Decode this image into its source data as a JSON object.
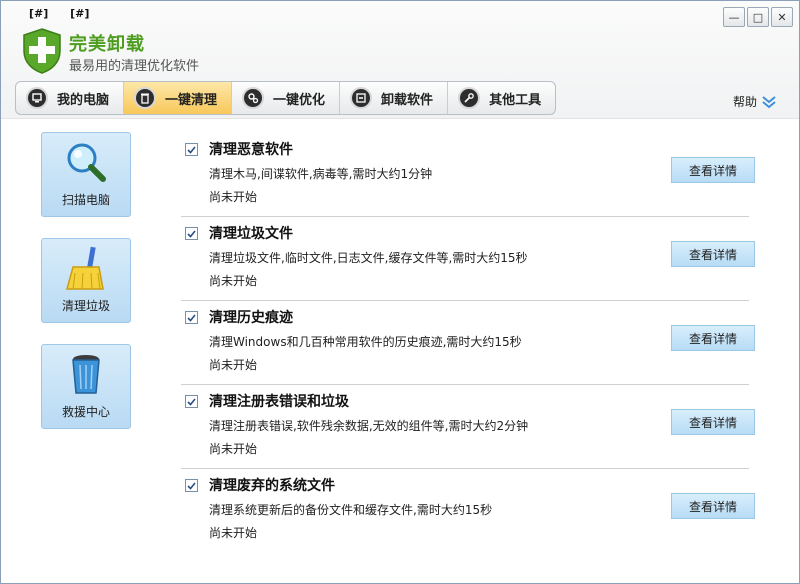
{
  "window": {
    "tags": [
      "[#]",
      "[#]"
    ],
    "title": "完美卸载",
    "subtitle": "最易用的清理优化软件",
    "controls": {
      "minimize": "—",
      "maximize": "□",
      "close": "✕"
    }
  },
  "tabs": [
    {
      "label": "我的电脑",
      "icon": "computer-icon",
      "active": false
    },
    {
      "label": "一键清理",
      "icon": "trash-icon",
      "active": true
    },
    {
      "label": "一键优化",
      "icon": "gears-icon",
      "active": false
    },
    {
      "label": "卸载软件",
      "icon": "uninstall-icon",
      "active": false
    },
    {
      "label": "其他工具",
      "icon": "tools-icon",
      "active": false
    }
  ],
  "help": {
    "label": "帮助"
  },
  "sidebar": [
    {
      "label": "扫描电脑",
      "icon": "magnifier-icon"
    },
    {
      "label": "清理垃圾",
      "icon": "broom-icon"
    },
    {
      "label": "救援中心",
      "icon": "recycle-bin-icon"
    }
  ],
  "items": [
    {
      "title": "清理恶意软件",
      "desc": "清理木马,间谍软件,病毒等,需时大约1分钟",
      "status": "尚未开始",
      "button": "查看详情",
      "checked": true
    },
    {
      "title": "清理垃圾文件",
      "desc": "清理垃圾文件,临时文件,日志文件,缓存文件等,需时大约15秒",
      "status": "尚未开始",
      "button": "查看详情",
      "checked": true
    },
    {
      "title": "清理历史痕迹",
      "desc": "清理Windows和几百种常用软件的历史痕迹,需时大约15秒",
      "status": "尚未开始",
      "button": "查看详情",
      "checked": true
    },
    {
      "title": "清理注册表错误和垃圾",
      "desc": "清理注册表错误,软件残余数据,无效的组件等,需时大约2分钟",
      "status": "尚未开始",
      "button": "查看详情",
      "checked": true
    },
    {
      "title": "清理废弃的系统文件",
      "desc": "清理系统更新后的备份文件和缓存文件,需时大约15秒",
      "status": "尚未开始",
      "button": "查看详情",
      "checked": true
    }
  ],
  "colors": {
    "brand": "#4d9d1f",
    "active_tab": "#f8c85a",
    "button": "#b7dcf5"
  }
}
